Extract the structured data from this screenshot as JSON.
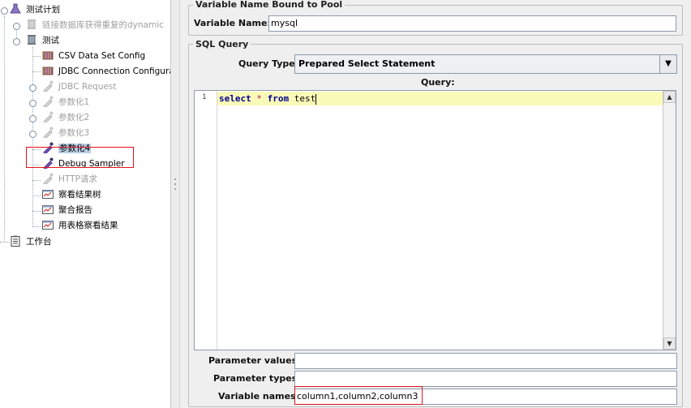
{
  "tree": {
    "root_label": "测试计划",
    "items": [
      {
        "label": "链接数据库获得重复的dynamic"
      },
      {
        "label": "测试"
      },
      {
        "label": "CSV Data Set Config"
      },
      {
        "label": "JDBC Connection Configurati"
      },
      {
        "label": "JDBC Request"
      },
      {
        "label": "参数化1"
      },
      {
        "label": "参数化2"
      },
      {
        "label": "参数化3"
      },
      {
        "label": "参数化4"
      },
      {
        "label": "Debug Sampler"
      },
      {
        "label": "HTTP请求"
      },
      {
        "label": "察看结果树"
      },
      {
        "label": "聚合报告"
      },
      {
        "label": "用表格察看结果"
      }
    ],
    "workbench_label": "工作台"
  },
  "pool": {
    "legend": "Variable Name Bound to Pool",
    "var_label": "Variable Name:",
    "var_value": "mysql"
  },
  "sql": {
    "legend": "SQL Query",
    "type_label": "Query Type:",
    "type_value": "Prepared Select Statement",
    "query_label": "Query:",
    "line_number": "1",
    "kw_select": "select",
    "star": "*",
    "kw_from": "from",
    "table": "test"
  },
  "params": {
    "values_label": "Parameter values:",
    "values_value": "",
    "types_label": "Parameter types:",
    "types_value": "",
    "names_label": "Variable names:",
    "names_value": "column1,column2,column3"
  },
  "colors": {
    "highlight_line": "#fafab8",
    "selection": "#b8cfe5",
    "annotation_red": "#e0141e",
    "keyword": "#00008b"
  }
}
